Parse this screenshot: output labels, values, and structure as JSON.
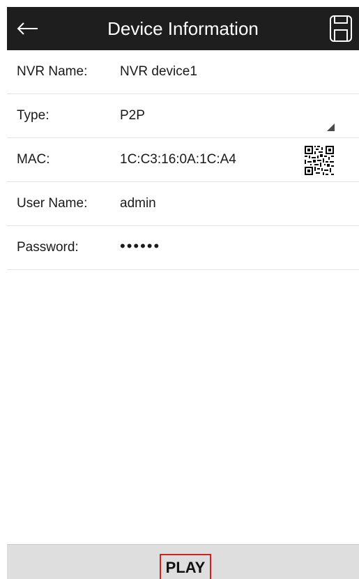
{
  "header": {
    "title": "Device Information",
    "back_icon": "arrow-left-icon",
    "save_icon": "floppy-save-icon",
    "background": "#1e1e1e"
  },
  "fields": [
    {
      "label": "NVR Name:",
      "value": "NVR device1"
    },
    {
      "label": "Type:",
      "value": "P2P",
      "control": "dropdown"
    },
    {
      "label": "MAC:",
      "value": "1C:C3:16:0A:1C:A4",
      "action_icon": "qr-code-icon"
    },
    {
      "label": "User Name:",
      "value": "admin"
    },
    {
      "label": "Password:",
      "value": "••••••"
    }
  ],
  "footer": {
    "play_label": "PLAY",
    "highlight_color": "#d42020"
  }
}
